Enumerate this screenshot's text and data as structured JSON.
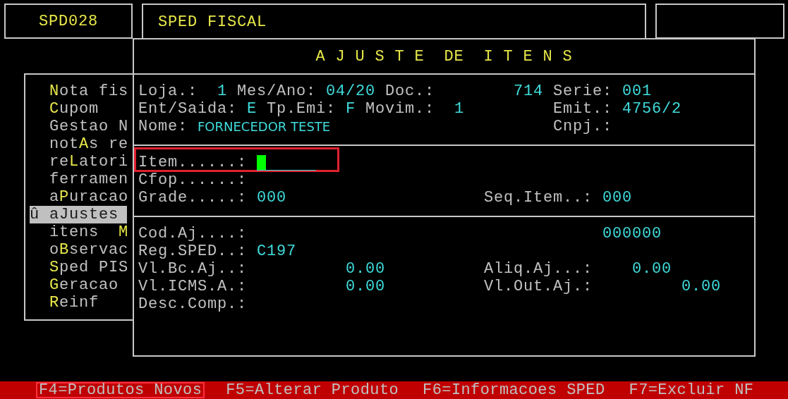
{
  "header": {
    "program_code": "SPD028",
    "title": "SPED FISCAL"
  },
  "menu": {
    "items": [
      {
        "hotkey": "N",
        "after": "ota fis",
        "selected": false
      },
      {
        "hotkey": "C",
        "after": "upom",
        "selected": false
      },
      {
        "before": "Gestao N",
        "selected": false
      },
      {
        "before": "not",
        "hotkey": "A",
        "after": "s re",
        "selected": false
      },
      {
        "before": "re",
        "hotkey": "L",
        "after": "atori",
        "selected": false
      },
      {
        "before": "ferramen",
        "selected": false
      },
      {
        "before": "a",
        "hotkey": "P",
        "after": "uracao",
        "selected": false
      },
      {
        "marker": "û",
        "before": "a",
        "hotkey": "J",
        "after": "ustes",
        "selected": true
      },
      {
        "before": "itens  ",
        "hotkey": "M",
        "selected": false
      },
      {
        "before": "o",
        "hotkey": "B",
        "after": "servac",
        "selected": false
      },
      {
        "hotkey": "S",
        "after": "ped PIS",
        "selected": false
      },
      {
        "hotkey": "G",
        "after": "eracao",
        "selected": false
      },
      {
        "hotkey": "R",
        "after": "einf",
        "selected": false
      }
    ]
  },
  "dialog": {
    "title": "A J U S T E  DE  I T E N S",
    "sections": [
      {
        "rows": [
          [
            {
              "label": "Loja.:",
              "value": "1"
            },
            {
              "label": "Mes/Ano:",
              "value": "04/20"
            },
            {
              "label": "Doc.:",
              "value": "714"
            },
            {
              "label": "Serie:",
              "value": "001"
            }
          ],
          [
            {
              "label": "Ent/Saida:",
              "value": "E"
            },
            {
              "label": "Tp.Emi:",
              "value": "F"
            },
            {
              "label": "Movim.:",
              "value": "1"
            },
            {
              "label": "Emit.:",
              "value": "4756/2"
            }
          ],
          [
            {
              "label": "Nome:",
              "value": "FORNECEDOR TESTE"
            },
            {},
            {},
            {
              "label": "Cnpj.:"
            }
          ]
        ]
      },
      {
        "rows": [
          [
            {
              "label": "Item......:",
              "kind": "input",
              "focused": true,
              "highlighted": true
            }
          ],
          [
            {
              "label": "Cfop......:"
            }
          ],
          [
            {
              "label": "Grade.....:",
              "value": "000"
            },
            {
              "label": "Seq.Item..:",
              "value": "000"
            }
          ]
        ]
      },
      {
        "rows": [
          [
            {
              "label": "Cod.Aj....:"
            },
            {
              "value": "000000"
            }
          ],
          [
            {
              "label": "Reg.SPED..:",
              "value": "C197"
            }
          ],
          [
            {
              "label": "Vl.Bc.Aj..:",
              "value": "0.00"
            },
            {
              "label": "Aliq.Aj...:",
              "value": "0.00"
            }
          ],
          [
            {
              "label": "Vl.ICMS.A.:",
              "value": "0.00"
            },
            {
              "label": "Vl.Out.Aj.:",
              "value": "0.00"
            }
          ],
          [
            {
              "label": "Desc.Comp.:"
            }
          ]
        ]
      }
    ]
  },
  "status_bar": {
    "keys": [
      {
        "label": "F4=Produtos Novos",
        "highlighted": true
      },
      {
        "label": "F5=Alterar Produto",
        "highlighted": false
      },
      {
        "label": "F6=Informacoes SPED",
        "highlighted": false
      },
      {
        "label": "F7=Excluir NF",
        "highlighted": false
      }
    ]
  }
}
